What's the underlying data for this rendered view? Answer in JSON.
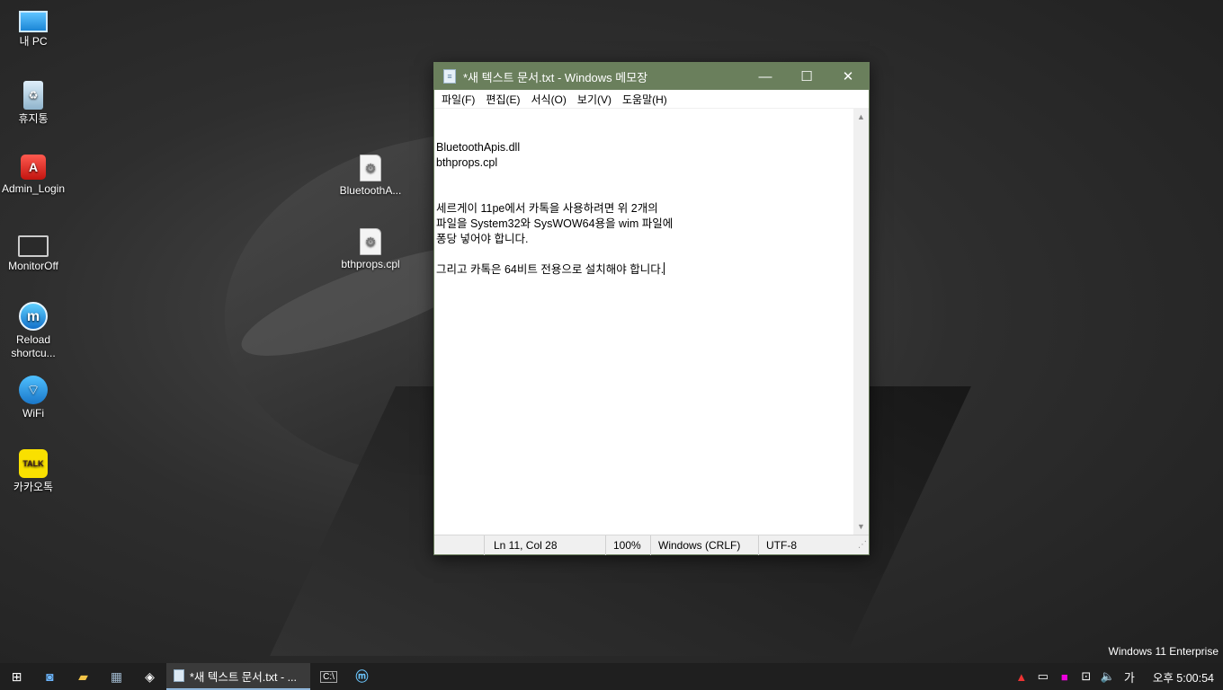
{
  "desktop": {
    "icons": [
      {
        "label": "내 PC",
        "icon": "computer-icon"
      },
      {
        "label": "휴지통",
        "icon": "recycle-bin-icon"
      },
      {
        "label": "Admin_Login",
        "icon": "admin-app-icon"
      },
      {
        "label": "MonitorOff",
        "icon": "laptop-icon"
      },
      {
        "label": "Reload shortcu...",
        "icon": "m-app-icon"
      },
      {
        "label": "WiFi",
        "icon": "wifi-icon"
      },
      {
        "label": "카카오톡",
        "icon": "kakaotalk-icon"
      },
      {
        "label": "BluetoothA...",
        "icon": "dll-file-icon"
      },
      {
        "label": "bthprops.cpl",
        "icon": "cpl-file-icon"
      }
    ],
    "watermark": "Windows 11 Enterprise"
  },
  "notepad": {
    "title": "*새 텍스트 문서.txt - Windows 메모장",
    "menu": [
      "파일(F)",
      "편집(E)",
      "서식(O)",
      "보기(V)",
      "도움말(H)"
    ],
    "lines": [
      "",
      "",
      "BluetoothApis.dll",
      "bthprops.cpl",
      "",
      "",
      "세르게이 11pe에서 카톡을 사용하려면 위 2개의",
      "파일을 System32와 SysWOW64용을 wim 파일에",
      "퐁당 넣어야 합니다.",
      "",
      "그리고 카톡은 64비트 전용으로 설치해야 합니다."
    ],
    "status": {
      "position": "Ln 11, Col 28",
      "zoom": "100%",
      "line_ending": "Windows (CRLF)",
      "encoding": "UTF-8"
    }
  },
  "taskbar": {
    "active_app_label": "*새 텍스트 문서.txt - ...",
    "ime_label": "가",
    "clock": "오후 5:00:54"
  }
}
